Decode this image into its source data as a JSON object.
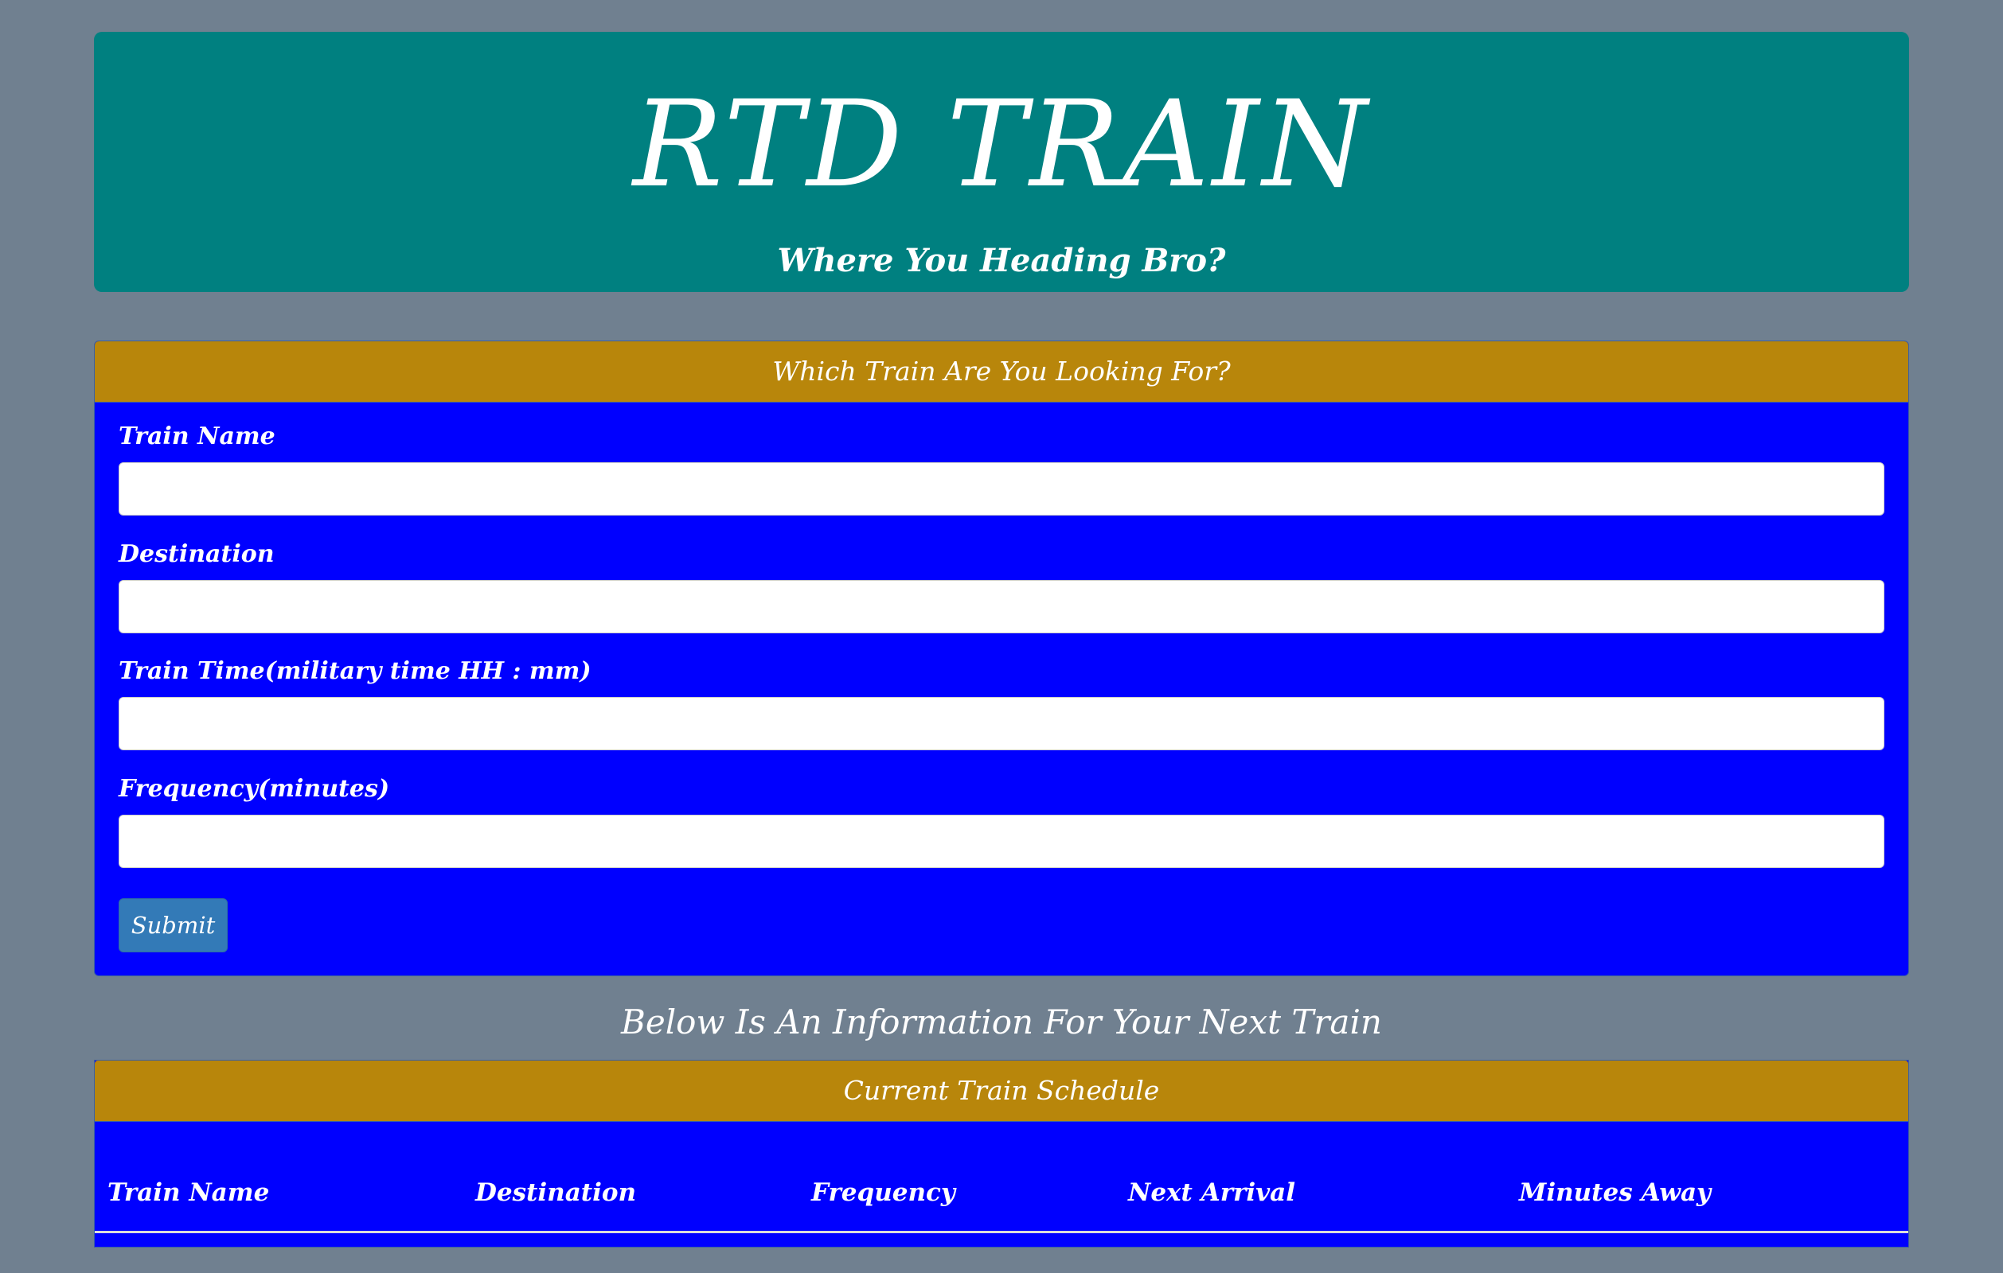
{
  "header": {
    "title": "RTD TRAIN",
    "subtitle": "Where You Heading Bro?"
  },
  "form_panel": {
    "heading": "Which Train Are You Looking For?",
    "fields": [
      {
        "label": "Train Name",
        "value": "",
        "placeholder": ""
      },
      {
        "label": "Destination",
        "value": "",
        "placeholder": ""
      },
      {
        "label": "Train Time(military time HH : mm)",
        "value": "",
        "placeholder": ""
      },
      {
        "label": "Frequency(minutes)",
        "value": "",
        "placeholder": ""
      }
    ],
    "submit_label": "Submit"
  },
  "info_heading": "Below Is An Information For Your Next Train",
  "schedule_panel": {
    "heading": "Current Train Schedule",
    "columns": [
      "Train Name",
      "Destination",
      "Frequency",
      "Next Arrival",
      "Minutes Away"
    ],
    "rows": []
  },
  "colors": {
    "page_background": "#708090",
    "jumbotron": "#008080",
    "panel_heading": "#b8860b",
    "panel_body": "#0000ff",
    "submit_button": "#337ab7"
  }
}
